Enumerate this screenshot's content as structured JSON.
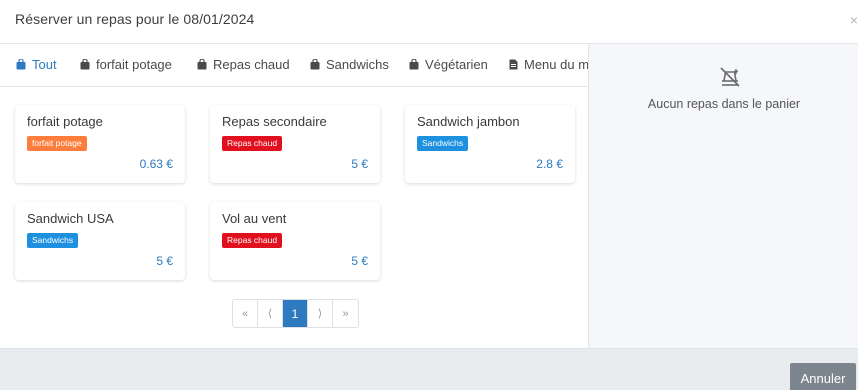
{
  "header": {
    "title": "Réserver un repas pour le 08/01/2024",
    "close_label": "×"
  },
  "tabs": [
    {
      "label": "Tout",
      "icon": "bag-icon",
      "active": true
    },
    {
      "label": "forfait potage",
      "icon": "bag-icon"
    },
    {
      "label": "Repas chaud",
      "icon": "bag-icon"
    },
    {
      "label": "Sandwichs",
      "icon": "bag-icon"
    },
    {
      "label": "Végétarien",
      "icon": "bag-icon"
    },
    {
      "label": "Menu du m",
      "icon": "document-icon"
    }
  ],
  "items": [
    {
      "name": "forfait potage",
      "category": "forfait potage",
      "color": "#fd7e3c",
      "price": "0.63 €"
    },
    {
      "name": "Repas secondaire",
      "category": "Repas chaud",
      "color": "#e0101f",
      "price": "5 €"
    },
    {
      "name": "Sandwich jambon",
      "category": "Sandwichs",
      "color": "#1e90e0",
      "price": "2.8 €"
    },
    {
      "name": "Sandwich USA",
      "category": "Sandwichs",
      "color": "#1e90e0",
      "price": "5 €"
    },
    {
      "name": "Vol au vent",
      "category": "Repas chaud",
      "color": "#e0101f",
      "price": "5 €"
    }
  ],
  "pagination": {
    "first": "«",
    "prev": "⟨",
    "current": "1",
    "next": "⟩",
    "last": "»"
  },
  "cart": {
    "empty_text": "Aucun repas dans le panier",
    "icon": "empty-cart-icon"
  },
  "footer": {
    "cancel_label": "Annuler"
  },
  "colors": {
    "accent": "#2d7ac0",
    "orange": "#fd7e3c",
    "red": "#e0101f",
    "blue": "#1e90e0"
  }
}
